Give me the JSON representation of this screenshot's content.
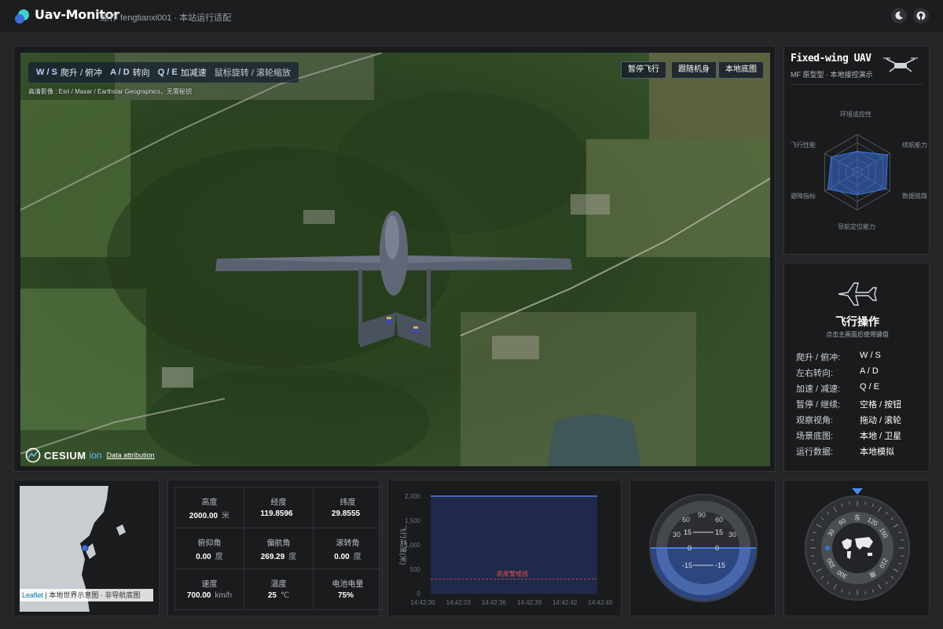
{
  "app": {
    "title": "Uav-Monitor",
    "subtitle": "原作 fengtianxi001 · 本站运行适配"
  },
  "header": {
    "theme_icon": "moon-icon",
    "repo_icon": "github-icon"
  },
  "viewer": {
    "hints": [
      {
        "keys": "W / S",
        "text": "爬升 / 俯冲"
      },
      {
        "keys": "A / D",
        "text": "转向"
      },
      {
        "keys": "Q / E",
        "text": "加减速"
      }
    ],
    "mouse_hint": "鼠标旋转 / 滚轮缩放",
    "imagery_credit": "高清影像 : Esri / Maxar / Earthstar Geographics，无需秘钥",
    "buttons": {
      "pause": "暂停飞行",
      "follow": "跟随机身",
      "basemap": "本地底图"
    },
    "cesium_brand": "CESIUM",
    "cesium_ion": "ion",
    "attribution_link": "Data attribution"
  },
  "uav": {
    "name": "Fixed-wing UAV",
    "model": "MF 原型型 · 本地接控演示",
    "radar": {
      "labels": [
        "环境适应性",
        "续航能力",
        "数据链路",
        "导航定位能力",
        "避障指标",
        "飞行性能"
      ],
      "values": [
        0.55,
        0.92,
        0.88,
        0.6,
        0.9,
        0.8
      ]
    }
  },
  "ops": {
    "title": "飞行操作",
    "subtitle": "点击主画面后使用键盘",
    "rows": [
      {
        "k": "爬升 / 俯冲:",
        "v": "W / S"
      },
      {
        "k": "左右转向:",
        "v": "A / D"
      },
      {
        "k": "加速 / 减速:",
        "v": "Q / E"
      },
      {
        "k": "暂停 / 继续:",
        "v": "空格 / 按钮"
      },
      {
        "k": "观察视角:",
        "v": "拖动 / 滚轮"
      },
      {
        "k": "场景底图:",
        "v": "本地 / 卫星"
      },
      {
        "k": "运行数据:",
        "v": "本地模拟"
      }
    ]
  },
  "map": {
    "leaflet": "Leaflet",
    "attribution": " | 本地世界示意图 · 非导航底图"
  },
  "telemetry": [
    {
      "label": "高度",
      "value": "2000.00",
      "unit": "米"
    },
    {
      "label": "经度",
      "value": "119.8596",
      "unit": ""
    },
    {
      "label": "纬度",
      "value": "29.8555",
      "unit": ""
    },
    {
      "label": "俯仰角",
      "value": "0.00",
      "unit": "度"
    },
    {
      "label": "偏航角",
      "value": "269.29",
      "unit": "度"
    },
    {
      "label": "滚转角",
      "value": "0.00",
      "unit": "度"
    },
    {
      "label": "速度",
      "value": "700.00",
      "unit": "km/h"
    },
    {
      "label": "温度",
      "value": "25",
      "unit": "℃"
    },
    {
      "label": "电池电量",
      "value": "75%",
      "unit": ""
    }
  ],
  "chart_data": {
    "type": "area",
    "ylabel": "飞行高度(米)",
    "x": [
      "14:42:30",
      "14:42:33",
      "14:42:36",
      "14:42:39",
      "14:42:42",
      "14:42:45"
    ],
    "series": [
      {
        "values": [
          2000,
          2000,
          2000,
          2000,
          2000,
          2000
        ]
      }
    ],
    "ylim": [
      0,
      2000
    ],
    "yticks": [
      "0",
      "500",
      "1,000",
      "1,500",
      "2,000"
    ],
    "threshold": {
      "label": "高度警戒线",
      "value": 300
    }
  },
  "attitude": {
    "pitch_ticks": [
      "15",
      "0",
      "-15"
    ],
    "roll_ticks": [
      "30",
      "60",
      "90",
      "60",
      "30"
    ]
  },
  "compass": {
    "labels": [
      "30",
      "60",
      "东",
      "120",
      "150",
      "210",
      "南",
      "300",
      "330"
    ]
  },
  "colors": {
    "accent": "#3a6fd8",
    "panel": "#1a1b1d",
    "background": "#252628",
    "warning": "#e05050"
  }
}
